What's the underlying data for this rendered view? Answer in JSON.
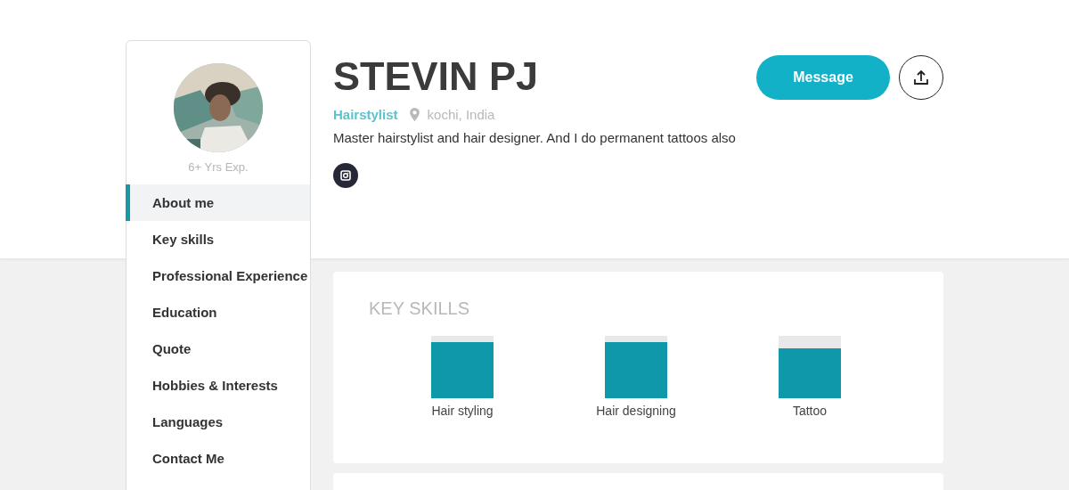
{
  "profile": {
    "experience": "6+ Yrs Exp.",
    "name": "STEVIN PJ",
    "role": "Hairstylist",
    "location": "kochi, India",
    "bio": "Master hairstylist and hair designer. And I do permanent tattoos also"
  },
  "actions": {
    "message_button": "Message"
  },
  "sidebar": {
    "items": [
      {
        "label": "About me",
        "selected": true
      },
      {
        "label": "Key skills",
        "selected": false
      },
      {
        "label": "Professional Experience",
        "selected": false
      },
      {
        "label": "Education",
        "selected": false
      },
      {
        "label": "Quote",
        "selected": false
      },
      {
        "label": "Hobbies & Interests",
        "selected": false
      },
      {
        "label": "Languages",
        "selected": false
      },
      {
        "label": "Contact Me",
        "selected": false
      }
    ]
  },
  "key_skills": {
    "title": "KEY SKILLS",
    "skills": [
      {
        "name": "Hair styling"
      },
      {
        "name": "Hair designing"
      },
      {
        "name": "Tattoo"
      }
    ]
  }
}
